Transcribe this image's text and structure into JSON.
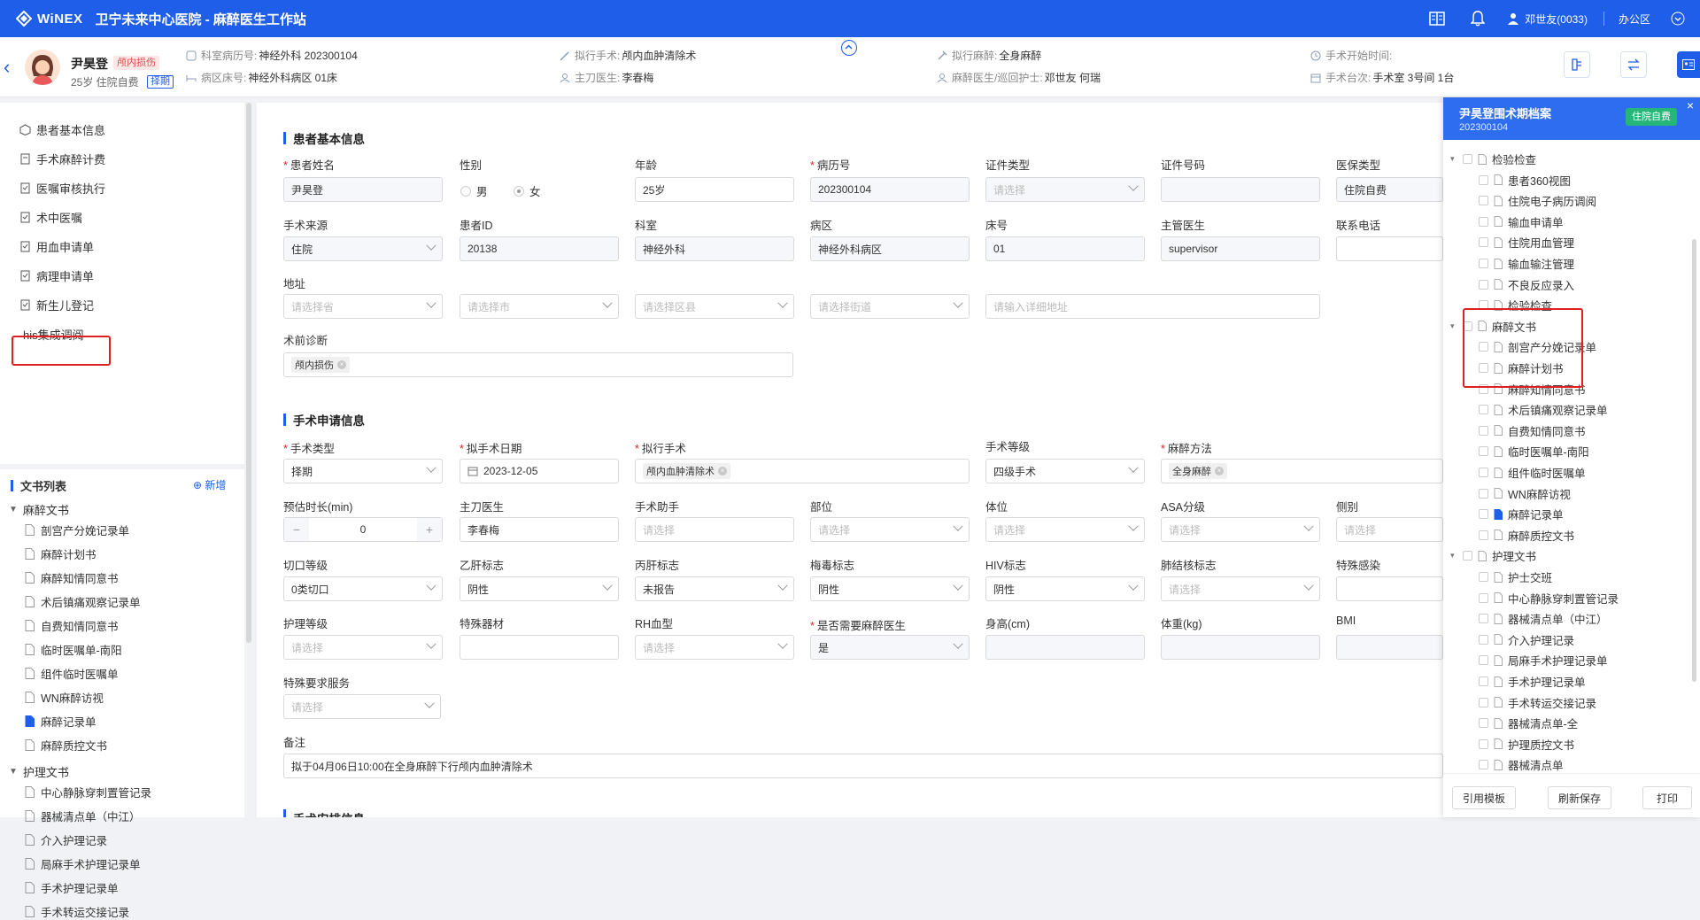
{
  "topbar": {
    "brand": "WiNEX",
    "hospital": "卫宁未来中心医院 - 麻醉医生工作站",
    "user": "邓世友(0033)",
    "zone": "办公区"
  },
  "patient": {
    "name": "尹昊登",
    "tag": "颅内损伤",
    "age_info": "25岁 住院自费",
    "sched_tag": "择期",
    "dept_record_label": "科室病历号:",
    "dept_record_value": "神经外科 202300104",
    "ward_label": "病区床号:",
    "ward_value": "神经外科病区 01床",
    "op_label": "拟行手术:",
    "op_value": "颅内血肿清除术",
    "surgeon_label": "主刀医生:",
    "surgeon_value": "李春梅",
    "anes_label": "拟行麻醉:",
    "anes_value": "全身麻醉",
    "anes_doc_label": "麻醉医生/巡回护士:",
    "anes_doc_value": "邓世友 何瑞",
    "start_label": "手术开始时间:",
    "start_value": "",
    "room_label": "手术台次:",
    "room_value": "手术室 3号间 1台"
  },
  "nav": {
    "items": [
      "患者基本信息",
      "手术麻醉计费",
      "医嘱审核执行",
      "术中医嘱",
      "用血申请单",
      "病理申请单",
      "新生儿登记",
      "his集成调阅"
    ],
    "doclist_title": "文书列表",
    "doclist_add": "新增",
    "group1": "麻醉文书",
    "group1_items": [
      "剖宫产分娩记录单",
      "麻醉计划书",
      "麻醉知情同意书",
      "术后镇痛观察记录单",
      "自费知情同意书",
      "临时医嘱单-南阳",
      "组件临时医嘱单",
      "WN麻醉访视",
      "麻醉记录单",
      "麻醉质控文书"
    ],
    "group2": "护理文书",
    "group2_items": [
      "中心静脉穿刺置管记录",
      "器械清点单（中江）",
      "介入护理记录",
      "局麻手术护理记录单",
      "手术护理记录单",
      "手术转运交接记录"
    ]
  },
  "section1": {
    "title": "患者基本信息",
    "labels": {
      "name": "患者姓名",
      "gender": "性别",
      "age": "年龄",
      "record": "病历号",
      "id_type": "证件类型",
      "id_no": "证件号码",
      "ins_type": "医保类型",
      "source": "手术来源",
      "pid": "患者ID",
      "dept": "科室",
      "ward": "病区",
      "bed": "床号",
      "doctor": "主管医生",
      "phone": "联系电话",
      "address": "地址",
      "diag": "术前诊断"
    },
    "values": {
      "name": "尹昊登",
      "male": "男",
      "female": "女",
      "age": "25岁",
      "record": "202300104",
      "id_type_ph": "请选择",
      "ins_type": "住院自费",
      "source": "住院",
      "pid": "20138",
      "dept": "神经外科",
      "ward": "神经外科病区",
      "bed": "01",
      "doctor": "supervisor",
      "addr1": "请选择省",
      "addr2": "请选择市",
      "addr3": "请选择区县",
      "addr4": "请选择街道",
      "addr5": "请输入详细地址",
      "diag": "颅内损伤"
    }
  },
  "section2": {
    "title": "手术申请信息",
    "labels": {
      "op_type": "手术类型",
      "op_date": "拟手术日期",
      "op": "拟行手术",
      "op_level": "手术等级",
      "anes_method": "麻醉方法",
      "duration": "预估时长(min)",
      "surgeon": "主刀医生",
      "assist": "手术助手",
      "site": "部位",
      "position": "体位",
      "asa": "ASA分级",
      "side": "侧别",
      "incision": "切口等级",
      "hbv": "乙肝标志",
      "hcv": "丙肝标志",
      "syph": "梅毒标志",
      "hiv": "HIV标志",
      "tb": "肺结核标志",
      "special_inf": "特殊感染",
      "nursing": "护理等级",
      "instrument": "特殊器材",
      "rh": "RH血型",
      "need_anes": "是否需要麻醉医生",
      "height": "身高(cm)",
      "weight": "体重(kg)",
      "bmi": "BMI",
      "special_service": "特殊要求服务",
      "remark": "备注"
    },
    "values": {
      "op_type": "择期",
      "op_date": "2023-12-05",
      "op": "颅内血肿清除术",
      "op_level": "四级手术",
      "anes_method": "全身麻醉",
      "duration": "0",
      "surgeon": "李春梅",
      "select_ph": "请选择",
      "incision": "0类切口",
      "hbv": "阴性",
      "hcv": "未报告",
      "syph": "阴性",
      "hiv": "阴性",
      "need_anes": "是",
      "remark": "拟于04月06日10:00在全身麻醉下行颅内血肿清除术"
    },
    "next_title": "手术安排信息"
  },
  "rpanel": {
    "title": "尹昊登围术期档案",
    "sub": "202300104",
    "badge": "住院自费",
    "group1": "检验检查",
    "group1_items": [
      "患者360视图",
      "住院电子病历调阅",
      "输血申请单",
      "住院用血管理",
      "输血输注管理",
      "不良反应录入",
      "检验检查"
    ],
    "group2": "麻醉文书",
    "group2_items": [
      "剖宫产分娩记录单",
      "麻醉计划书",
      "麻醉知情同意书",
      "术后镇痛观察记录单",
      "自费知情同意书",
      "临时医嘱单-南阳",
      "组件临时医嘱单",
      "WN麻醉访视",
      "麻醉记录单",
      "麻醉质控文书"
    ],
    "group3": "护理文书",
    "group3_items": [
      "护士交班",
      "中心静脉穿刺置管记录",
      "器械清点单（中江）",
      "介入护理记录",
      "局麻手术护理记录单",
      "手术护理记录单",
      "手术转运交接记录",
      "器械清点单-全",
      "护理质控文书",
      "器械清点单"
    ],
    "btn_template": "引用模板",
    "btn_refresh": "刷新保存",
    "btn_print": "打印"
  }
}
